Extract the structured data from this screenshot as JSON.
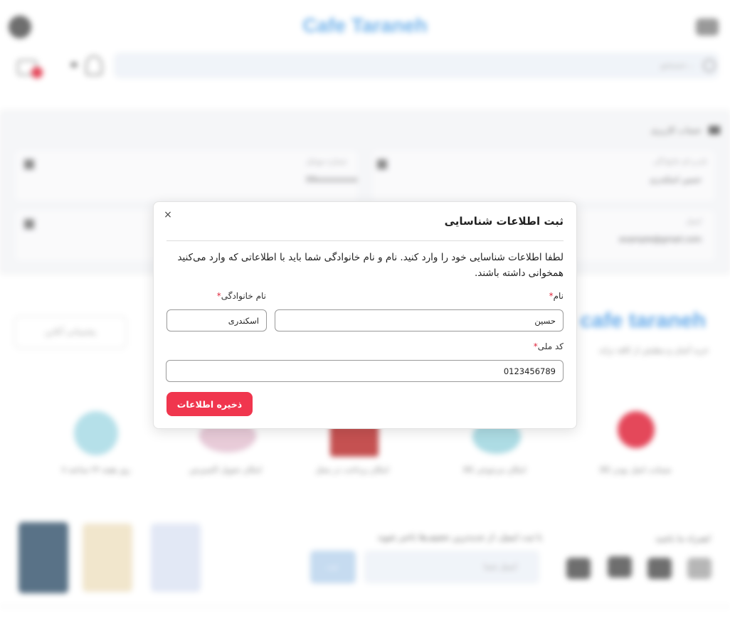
{
  "header": {
    "brand": "Cafe Taraneh",
    "search_placeholder": "جستجو..."
  },
  "profile": {
    "title": "حساب کاربری",
    "fields": [
      {
        "label": "نام و نام خانوادگی",
        "value": "حسین اسکندری"
      },
      {
        "label": "شماره موبایل",
        "value": "09xxxxxxxxx"
      },
      {
        "label": "ایمیل",
        "value": "example@gmail.com"
      }
    ]
  },
  "promo": {
    "brand": "cafe taraneh",
    "subtitle": "خرید آسان و مطمئن از کافه ترانه",
    "support_label": "پشتیبانی آنلاین"
  },
  "features": [
    {
      "label": "ضمانت اصل بودن کالا",
      "color": "#e0283e"
    },
    {
      "label": "امکان مرجوعی کالا",
      "color": "#2bb5c9"
    },
    {
      "label": "امکان پرداخت در محل",
      "color": "#c9283a"
    },
    {
      "label": "امکان تحویل اکسپرس",
      "color": "#d86a9c"
    },
    {
      "label": "۷ روز هفته ۲۴ ساعته",
      "color": "#2bb5c9"
    }
  ],
  "footer": {
    "social_title": "همراه ما باشید!",
    "newsletter_title": "با ثبت ایمیل، از جدیدترین تخفیف‌ها باخبر شوید",
    "newsletter_placeholder": "ایمیل شما",
    "newsletter_button": "ثبت"
  },
  "modal": {
    "title": "ثبت اطلاعات شناسایی",
    "close_glyph": "×",
    "description": "لطفا اطلاعات شناسایی خود را وارد کنید. نام و نام خانوادگی شما باید با اطلاعاتی که وارد می‌کنید همخوانی داشته باشند.",
    "first_name_label": "نام",
    "last_name_label": "نام خانوادگی",
    "national_id_label": "کد ملی",
    "required_mark": "*",
    "first_name_value": "حسین",
    "last_name_value": "اسکندری",
    "national_id_value": "0123456789",
    "save_label": "ذخیره اطلاعات"
  },
  "colors": {
    "accent": "#f0364e",
    "brand_blue": "#4a9be6"
  }
}
